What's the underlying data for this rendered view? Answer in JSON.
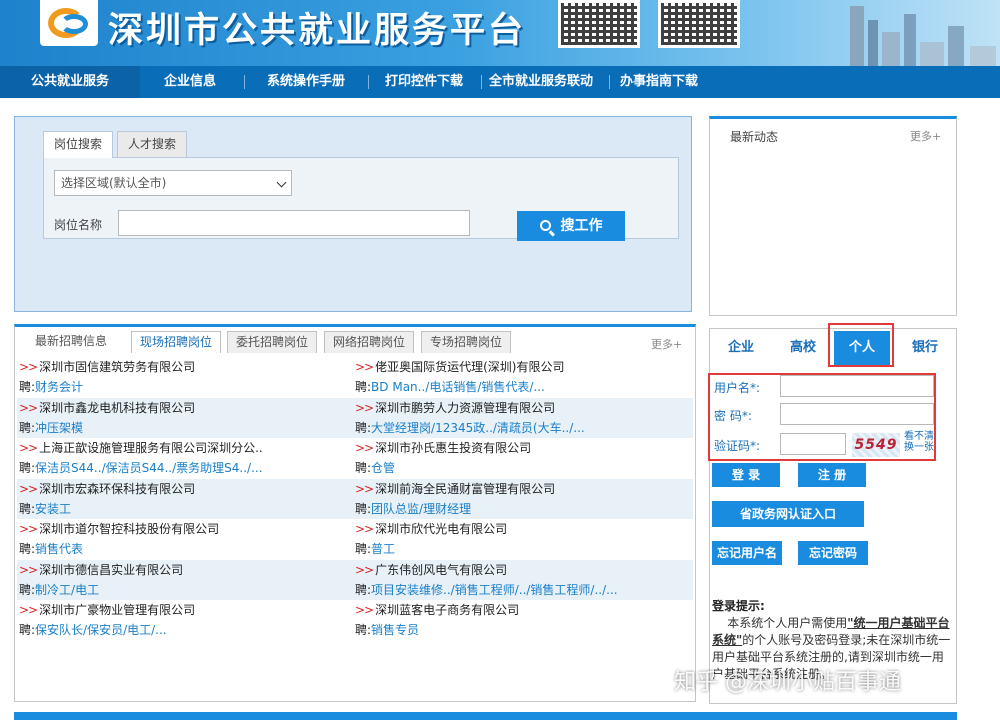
{
  "header": {
    "site_title": "深圳市公共就业服务平台"
  },
  "nav": {
    "items": [
      "公共就业服务",
      "企业信息",
      "系统操作手册",
      "打印控件下载",
      "全市就业服务联动",
      "办事指南下载"
    ]
  },
  "search": {
    "tabs": [
      "岗位搜索",
      "人才搜索"
    ],
    "region_select": "选择区域(默认全市)",
    "job_label": "岗位名称",
    "job_value": "",
    "button": "搜工作"
  },
  "news": {
    "title": "最新动态",
    "more": "更多+"
  },
  "jobs": {
    "tabs": [
      "最新招聘信息",
      "现场招聘岗位",
      "委托招聘岗位",
      "网络招聘岗位",
      "专场招聘岗位"
    ],
    "more": "更多+",
    "arrow": ">>",
    "hire_prefix": "聘:",
    "rows": [
      {
        "left": {
          "company": "深圳市固信建筑劳务有限公司",
          "positions": "财务会计"
        },
        "right": {
          "company": "佬亚奥国际货运代理(深圳)有限公司",
          "positions": "BD Man../电话销售/销售代表/..."
        }
      },
      {
        "left": {
          "company": "深圳市鑫龙电机科技有限公司",
          "positions": "冲压架模"
        },
        "right": {
          "company": "深圳市鹏劳人力资源管理有限公司",
          "positions": "大堂经理岗/12345政../清疏员(大车../..."
        }
      },
      {
        "left": {
          "company": "上海正歆设施管理服务有限公司深圳分公..",
          "positions": "保洁员S44../保洁员S44../票务助理S4../..."
        },
        "right": {
          "company": "深圳市孙氏惠生投资有限公司",
          "positions": "仓管"
        }
      },
      {
        "left": {
          "company": "深圳市宏森环保科技有限公司",
          "positions": "安装工"
        },
        "right": {
          "company": "深圳前海全民通财富管理有限公司",
          "positions": "团队总监/理财经理"
        }
      },
      {
        "left": {
          "company": "深圳市道尔智控科技股份有限公司",
          "positions": "销售代表"
        },
        "right": {
          "company": "深圳市欣代光电有限公司",
          "positions": "普工"
        }
      },
      {
        "left": {
          "company": "深圳市德信昌实业有限公司",
          "positions": "制冷工/电工"
        },
        "right": {
          "company": "广东伟创风电气有限公司",
          "positions": "项目安装维修../销售工程师/../销售工程师/../..."
        }
      },
      {
        "left": {
          "company": "深圳市广豪物业管理有限公司",
          "positions": "保安队长/保安员/电工/..."
        },
        "right": {
          "company": "深圳蓝客电子商务有限公司",
          "positions": "销售专员"
        }
      }
    ]
  },
  "login": {
    "tabs": [
      "企业",
      "高校",
      "个人",
      "银行"
    ],
    "active_tab": "个人",
    "username_label": "用户名*:",
    "password_label": "密  码*:",
    "captcha_label": "验证码*:",
    "captcha_value": "5549",
    "captcha_refresh": "看不清 换一张",
    "login_button": "登 录",
    "register_button": "注 册",
    "gov_auth_button": "省政务网认证入口",
    "forgot_user_button": "忘记用户名",
    "forgot_pwd_button": "忘记密码",
    "hint_title": "登录提示:",
    "hint_text_1": "本系统个人用户需使用",
    "hint_emph": "\"统一用户基础平台系统\"",
    "hint_text_2": "的个人账号及密码登录;未在深圳市统一用户基础平台系统注册的,请到深圳市统一用户基础平台系统注册。"
  },
  "watermark": "知乎 @深圳小贴百事通",
  "colors": {
    "primary": "#1a8ce0",
    "nav": "#0a6db8",
    "link": "#1a7fc8",
    "highlight": "#e03a3a"
  }
}
